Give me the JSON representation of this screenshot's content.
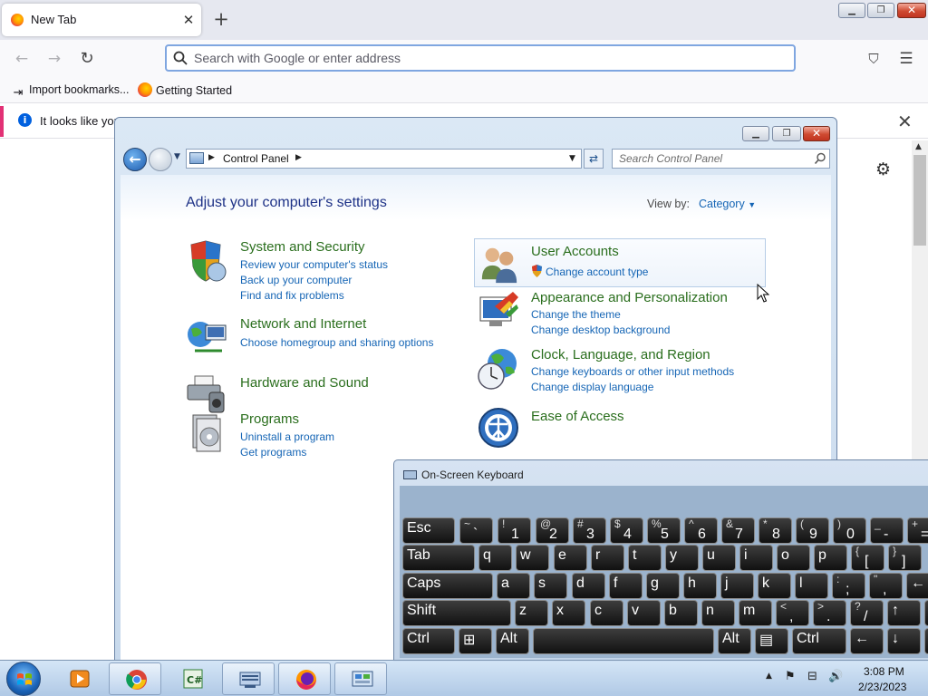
{
  "browser": {
    "tab_title": "New Tab",
    "tab_close": "✕",
    "newtab": "+",
    "win_min": "▁",
    "win_max": "❐",
    "win_close": "✕",
    "back": "←",
    "forward": "→",
    "reload": "↻",
    "address_placeholder": "Search with Google or enter address",
    "pocket": "⛉",
    "menu": "☰",
    "bookmarks": [
      {
        "label": "Import bookmarks...",
        "icon": "⇥"
      },
      {
        "label": "Getting Started",
        "icon": ""
      }
    ],
    "notice_icon": "i",
    "notice_text": "It looks like you",
    "notice_close": "✕",
    "gear": "⚙",
    "scroll_up": "▲"
  },
  "control_panel": {
    "address_breadcrumb": "Control Panel",
    "crumb_arrow": "▶",
    "dropdown": "▼",
    "refresh": "⇄",
    "search_placeholder": "Search Control Panel",
    "heading": "Adjust your computer's settings",
    "view_by_label": "View by:",
    "view_by_value": "Category",
    "view_by_caret": "▼",
    "categories": [
      {
        "title": "System and Security",
        "links": [
          "Review your computer's status",
          "Back up your computer",
          "Find and fix problems"
        ]
      },
      {
        "title": "Network and Internet",
        "links": [
          "Choose homegroup and sharing options"
        ]
      },
      {
        "title": "Hardware and Sound",
        "links": []
      },
      {
        "title": "Programs",
        "links": [
          "Uninstall a program",
          "Get programs"
        ]
      },
      {
        "title": "User Accounts",
        "links": [
          "Change account type"
        ]
      },
      {
        "title": "Appearance and Personalization",
        "links": [
          "Change the theme",
          "Change desktop background"
        ]
      },
      {
        "title": "Clock, Language, and Region",
        "links": [
          "Change keyboards or other input methods",
          "Change display language"
        ]
      },
      {
        "title": "Ease of Access",
        "links": []
      }
    ]
  },
  "osk": {
    "title": "On-Screen Keyboard",
    "rows": [
      [
        {
          "m": "Esc"
        },
        {
          "s": "~",
          "m": "`"
        },
        {
          "s": "!",
          "m": "1"
        },
        {
          "s": "@",
          "m": "2"
        },
        {
          "s": "#",
          "m": "3"
        },
        {
          "s": "$",
          "m": "4"
        },
        {
          "s": "%",
          "m": "5"
        },
        {
          "s": "^",
          "m": "6"
        },
        {
          "s": "&",
          "m": "7"
        },
        {
          "s": "*",
          "m": "8"
        },
        {
          "s": "(",
          "m": "9"
        },
        {
          "s": ")",
          "m": "0"
        },
        {
          "s": "_",
          "m": "-"
        },
        {
          "s": "+",
          "m": "="
        }
      ],
      [
        {
          "m": "Tab"
        },
        {
          "m": "q"
        },
        {
          "m": "w"
        },
        {
          "m": "e"
        },
        {
          "m": "r"
        },
        {
          "m": "t"
        },
        {
          "m": "y"
        },
        {
          "m": "u"
        },
        {
          "m": "i"
        },
        {
          "m": "o"
        },
        {
          "m": "p"
        },
        {
          "s": "{",
          "m": "["
        },
        {
          "s": "}",
          "m": "]"
        }
      ],
      [
        {
          "m": "Caps"
        },
        {
          "m": "a"
        },
        {
          "m": "s"
        },
        {
          "m": "d"
        },
        {
          "m": "f"
        },
        {
          "m": "g"
        },
        {
          "m": "h"
        },
        {
          "m": "j"
        },
        {
          "m": "k"
        },
        {
          "m": "l"
        },
        {
          "s": ":",
          "m": ";"
        },
        {
          "s": "\"",
          "m": ","
        },
        {
          "m": "←"
        }
      ],
      [
        {
          "m": "Shift"
        },
        {
          "m": "z"
        },
        {
          "m": "x"
        },
        {
          "m": "c"
        },
        {
          "m": "v"
        },
        {
          "m": "b"
        },
        {
          "m": "n"
        },
        {
          "m": "m"
        },
        {
          "s": "<",
          "m": ","
        },
        {
          "s": ">",
          "m": "."
        },
        {
          "s": "?",
          "m": "/"
        },
        {
          "m": "↑"
        },
        {
          "m": ""
        }
      ],
      [
        {
          "m": "Ctrl"
        },
        {
          "m": "⊞"
        },
        {
          "m": "Alt"
        },
        {
          "m": ""
        },
        {
          "m": "Alt"
        },
        {
          "m": "▤"
        },
        {
          "m": "Ctrl"
        },
        {
          "m": "←"
        },
        {
          "m": "↓"
        },
        {
          "m": ""
        }
      ]
    ]
  },
  "taskbar": {
    "tray_arrow": "▲",
    "tray_flag": "⚑",
    "tray_network": "⊟",
    "tray_volume": "🔊",
    "time": "3:08 PM",
    "date": "2/23/2023"
  }
}
